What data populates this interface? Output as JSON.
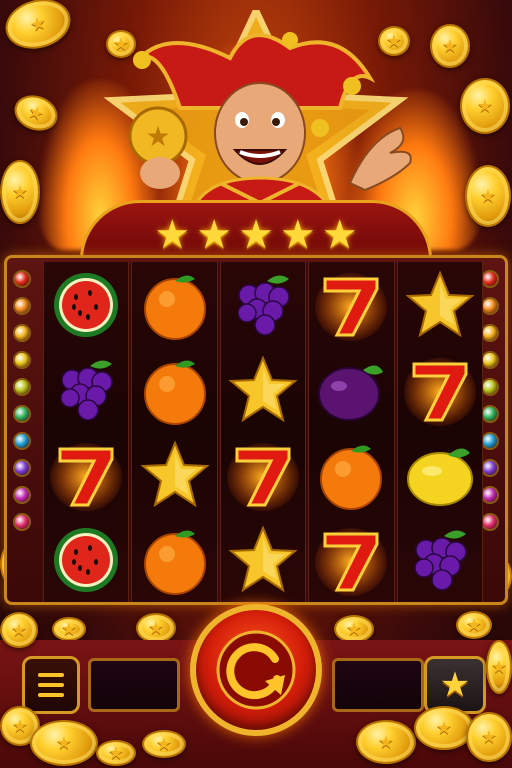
{
  "banner": {
    "stars": 5
  },
  "reels": [
    [
      "watermelon",
      "grapes",
      "seven",
      "watermelon"
    ],
    [
      "orange",
      "orange",
      "star",
      "orange"
    ],
    [
      "grapes",
      "star",
      "seven",
      "star"
    ],
    [
      "seven",
      "plum",
      "orange",
      "seven"
    ],
    [
      "star",
      "seven",
      "lemon",
      "grapes"
    ]
  ],
  "side_lights": [
    "#e02a1a",
    "#f08a1a",
    "#f0b01a",
    "#e8c41a",
    "#b8c41a",
    "#2ab05a",
    "#1a9ad0",
    "#7a3ad0",
    "#c02ab0",
    "#e02a6a"
  ],
  "controls": {
    "menu_icon": "menu-icon",
    "spin_icon": "spin-arrow-icon",
    "favorite_icon": "star-icon",
    "left_display": "",
    "right_display": ""
  },
  "colors": {
    "gold": "#f0b42c",
    "red": "#d41e0a",
    "frame": "#c9861a"
  }
}
